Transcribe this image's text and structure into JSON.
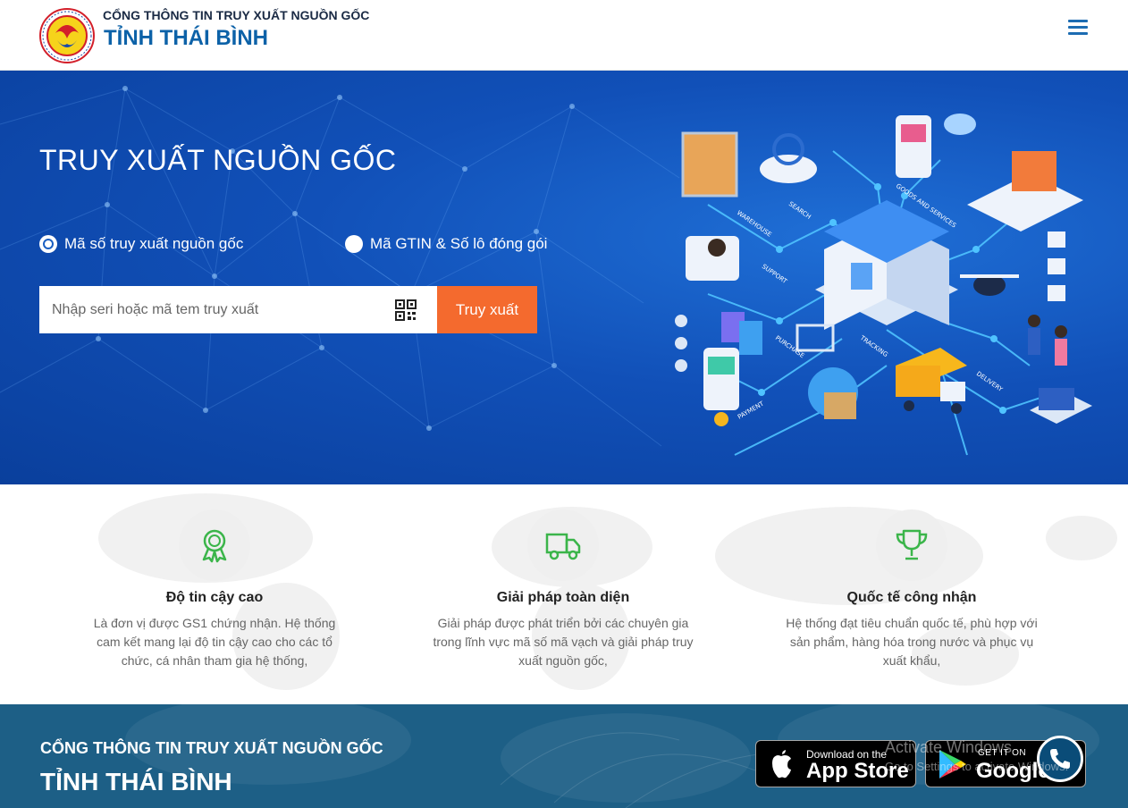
{
  "header": {
    "brand_top": "CỔNG THÔNG TIN TRUY XUẤT NGUỒN GỐC",
    "brand_main": "TỈNH THÁI BÌNH"
  },
  "hero": {
    "title": "TRUY XUẤT NGUỒN GỐC",
    "radio_options": [
      {
        "label": "Mã số truy xuất nguồn gốc",
        "checked": true
      },
      {
        "label": "Mã GTIN & Số lô đóng gói",
        "checked": false
      }
    ],
    "search_placeholder": "Nhập seri hoặc mã tem truy xuất",
    "search_button": "Truy xuất",
    "illustration_labels": [
      "WAREHOUSE",
      "SEARCH",
      "GOODS AND SERVICES",
      "SUPPORT",
      "PURCHASE",
      "TRACKING",
      "DELIVERY",
      "PAYMENT"
    ]
  },
  "features": [
    {
      "icon": "award-icon",
      "title": "Độ tin cậy cao",
      "desc": "Là đơn vị được GS1 chứng nhận. Hệ thống cam kết mang lại độ tin cậy cao cho các tổ chức, cá nhân tham gia hệ thống,"
    },
    {
      "icon": "truck-icon",
      "title": "Giải pháp toàn diện",
      "desc": "Giải pháp được phát triển bởi các chuyên gia trong lĩnh vực mã số mã vạch và giải pháp truy xuất nguồn gốc,"
    },
    {
      "icon": "trophy-icon",
      "title": "Quốc tế công nhận",
      "desc": "Hệ thống đạt tiêu chuẩn quốc tế, phù hợp với sản phẩm, hàng hóa trong nước và phục vụ xuất khẩu,"
    }
  ],
  "footer": {
    "brand_top": "CỔNG THÔNG TIN TRUY XUẤT NGUỒN GỐC",
    "brand_main": "TỈNH THÁI BÌNH",
    "app_store_small": "Download on the",
    "app_store_big": "App Store",
    "google_small": "GET IT ON",
    "google_big": "Google",
    "watermark_title": "Activate Windows",
    "watermark_sub": "Go to Settings to activate Windows."
  },
  "colors": {
    "brand_blue": "#0d62a8",
    "hero_blue": "#1150b8",
    "search_button": "#f46a2e",
    "footer_bg": "#1d5f86",
    "feature_icon_green": "#3bb54a"
  }
}
